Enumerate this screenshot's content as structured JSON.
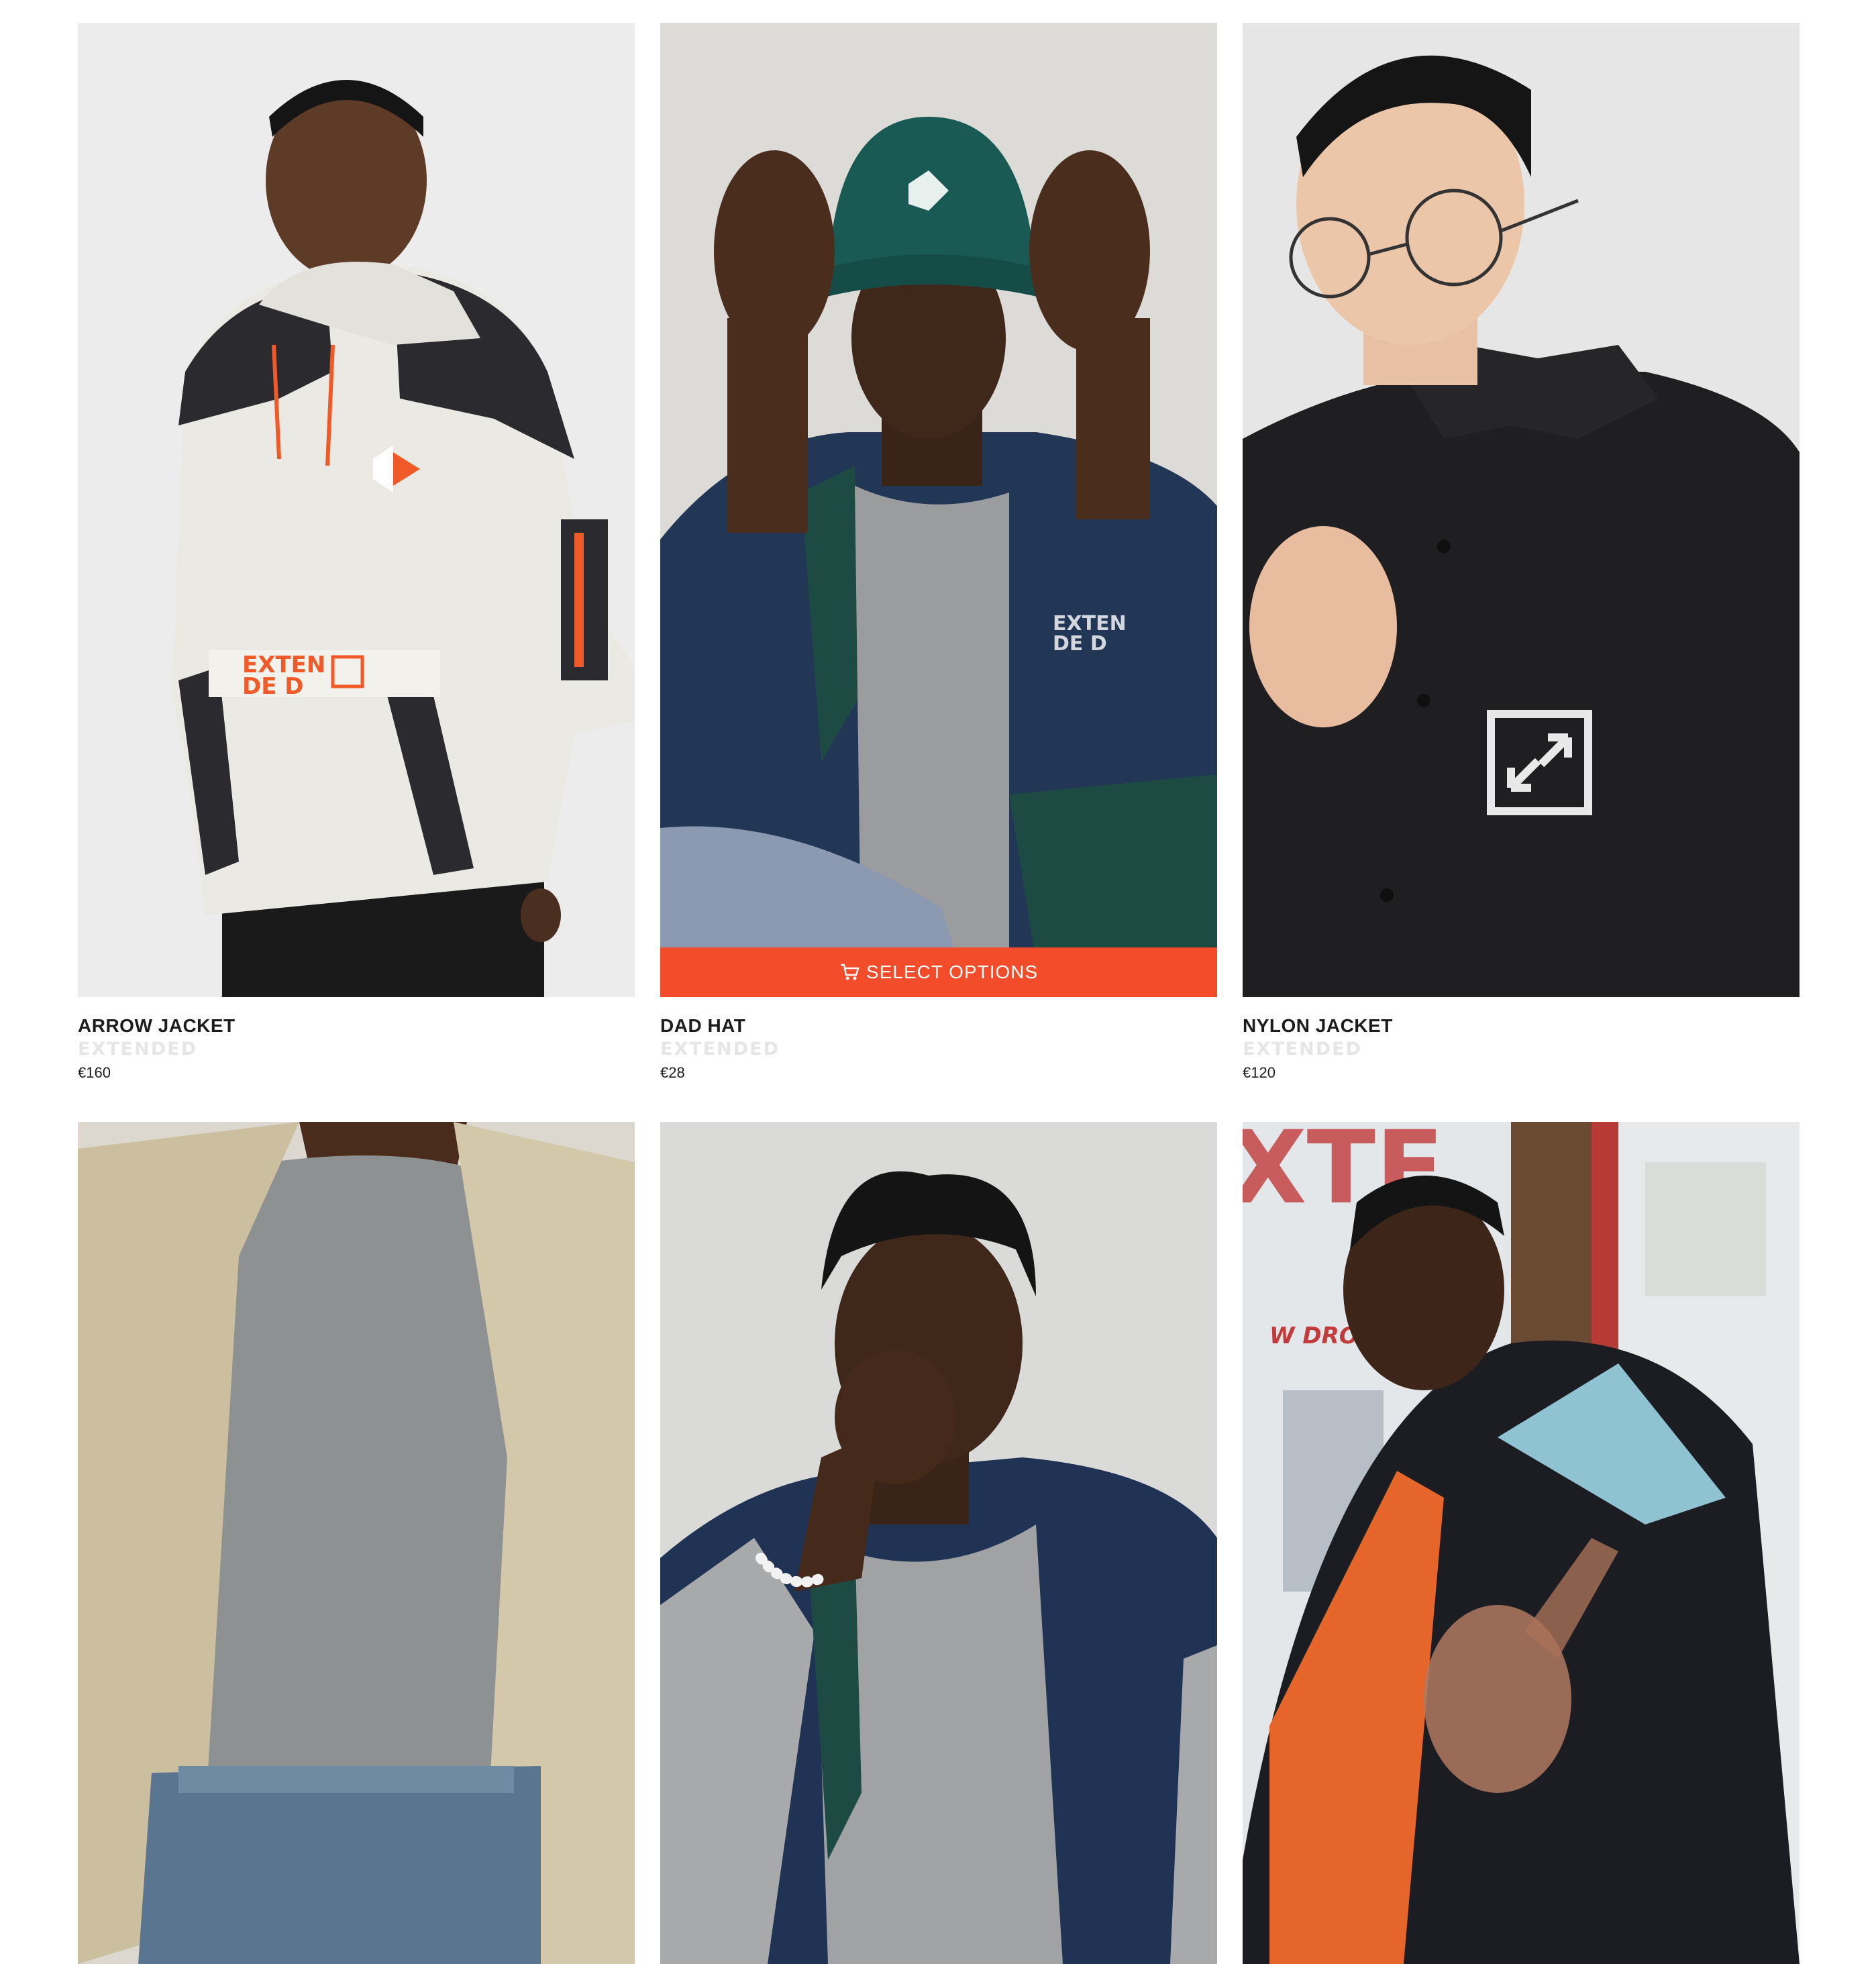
{
  "products_row1": [
    {
      "title": "ARROW JACKET",
      "brand": "EXTENDED",
      "price": "€160",
      "chest_logo": "EXTEN DED",
      "bg": "#ececec"
    },
    {
      "title": "DAD HAT",
      "brand": "EXTENDED",
      "price": "€28",
      "chest_logo": "EXTEN DED",
      "bg": "#dcdcdc",
      "hover_button": "SELECT OPTIONS"
    },
    {
      "title": "NYLON JACKET",
      "brand": "EXTENDED",
      "price": "€120",
      "bg": "#e4e4e4"
    }
  ],
  "products_row2": [
    {
      "bg": "#d8d4cc"
    },
    {
      "bg": "#dadada"
    },
    {
      "bg": "#c9cfd4",
      "poster_text": "W DROP"
    }
  ],
  "colors": {
    "accent": "#f34c2a",
    "title": "#1c1c1c",
    "brand": "#e6e6e6"
  },
  "icons": {
    "select_options": "cart-icon"
  }
}
